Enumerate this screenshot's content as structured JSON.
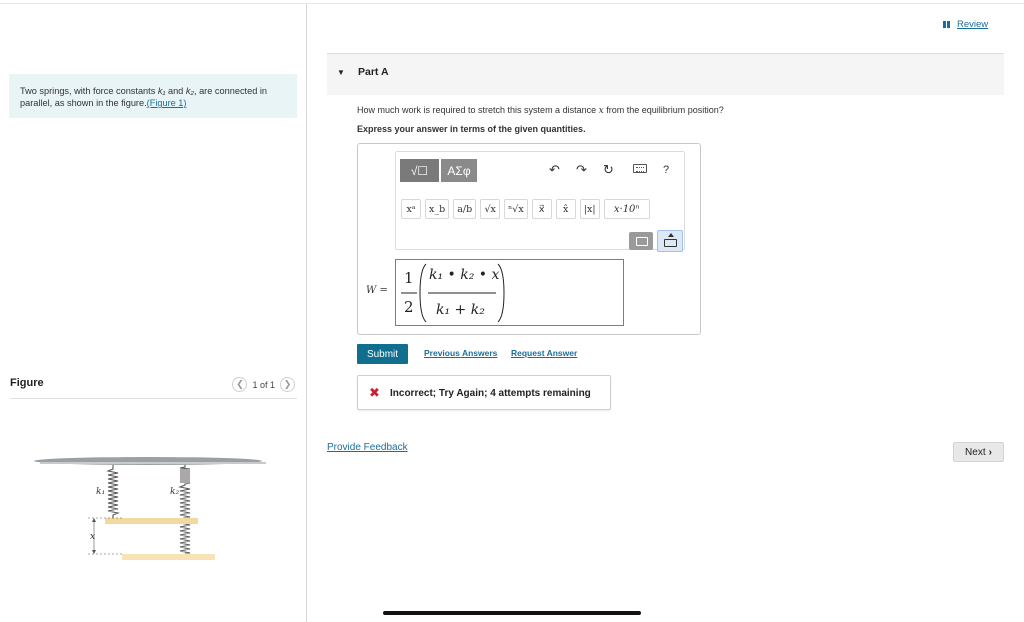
{
  "header": {
    "review_label": "Review"
  },
  "problem": {
    "intro_text": "Two springs, with force constants",
    "k1": "k₁",
    "and": "and",
    "k2": "k₂",
    "intro_text_2": ", are connected in parallel, as shown in the figure.",
    "figure_link": "(Figure 1)"
  },
  "figure": {
    "label": "Figure",
    "pager": "1 of 1",
    "prev_icon": "chevron-left-icon",
    "next_icon": "chevron-right-icon",
    "spring1_label": "k₁",
    "spring2_label": "k₂",
    "displacement_label": "x",
    "colors": {
      "ceiling": "#9aa0a3",
      "block_top": "#f1d9a0",
      "block_bottom": "#f7e3b5",
      "spring": "#555555"
    }
  },
  "part": {
    "title": "Part A",
    "question_pre": "How much work is required to stretch this system a distance",
    "question_var": "x",
    "question_post": "from the equilibrium position?",
    "instruction": "Express your answer in terms of the given quantities."
  },
  "editor": {
    "templates_button": "√☐",
    "symbols_button": "ΑΣφ",
    "undo_icon": "undo-icon",
    "redo_icon": "redo-icon",
    "reset_icon": "reset-icon",
    "keyboard_icon": "keyboard-icon",
    "help_label": "?",
    "template_buttons": [
      "xᵃ",
      "x_b",
      "a/b",
      "√x",
      "ⁿ√x",
      "x⃗",
      "x̂",
      "|x|"
    ],
    "sci_notation": "x·10ⁿ",
    "delete_icon": "backspace-icon",
    "keyboard_toggle_icon": "keyboard-toggle-icon",
    "answer_label": "W =",
    "answer": {
      "coef_num": "1",
      "coef_den": "2",
      "numerator": "k₁ • k₂ • x",
      "denominator": "k₁ + k₂"
    }
  },
  "actions": {
    "submit_label": "Submit",
    "previous_answers": "Previous Answers",
    "request_answer": "Request Answer",
    "feedback_message": "Incorrect; Try Again; 4 attempts remaining",
    "provide_feedback": "Provide Feedback",
    "next_label": "Next"
  },
  "colors": {
    "accent": "#106f8f",
    "link": "#1c6e9a",
    "error": "#c8202f",
    "intro_bg": "#e8f4f6"
  }
}
